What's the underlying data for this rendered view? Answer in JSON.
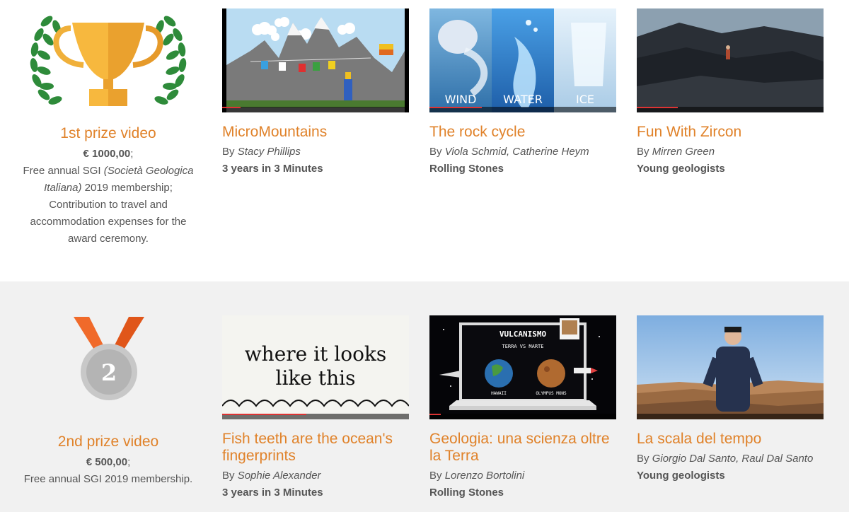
{
  "first_prize": {
    "title": "1st prize video",
    "amount": "€ 1000,00",
    "line1_pre": "Free annual SGI ",
    "line1_italic": "(Società Geologica Italiana)",
    "line1_post": " 2019 membership;",
    "line2": "Contribution to travel and accommodation expenses for the award ceremony."
  },
  "second_prize": {
    "title": "2nd prize video",
    "amount": "€ 500,00",
    "line1": "Free annual SGI 2019 membership."
  },
  "row1": [
    {
      "title": "MicroMountains",
      "by_prefix": "By",
      "authors": "Stacy Phillips",
      "category": "3 years in 3 Minutes"
    },
    {
      "title": "The rock cycle",
      "by_prefix": "By",
      "authors": "Viola Schmid, Catherine Heym",
      "category": "Rolling Stones",
      "thumb_words": [
        "WIND",
        "WATER",
        "ICE"
      ]
    },
    {
      "title": "Fun With Zircon",
      "by_prefix": "By",
      "authors": "Mirren Green",
      "category": "Young geologists"
    }
  ],
  "row2": [
    {
      "title": "Fish teeth are the ocean's fingerprints",
      "by_prefix": "By",
      "authors": "Sophie Alexander",
      "category": "3 years in 3 Minutes",
      "thumb_text": "where it looks like this"
    },
    {
      "title": "Geologia: una scienza oltre la Terra",
      "by_prefix": "By",
      "authors": "Lorenzo Bortolini",
      "category": "Rolling Stones",
      "thumb_heading": "VULCANISMO",
      "thumb_sub": "TERRA VS MARTE",
      "thumb_left": "HAWAII",
      "thumb_right": "OLYMPUS MONS"
    },
    {
      "title": "La scala del tempo",
      "by_prefix": "By",
      "authors": "Giorgio Dal Santo, Raul Dal Santo",
      "category": "Young geologists"
    }
  ],
  "colors": {
    "accent": "#e0822a",
    "text": "#555555",
    "band": "#f1f1f1"
  }
}
